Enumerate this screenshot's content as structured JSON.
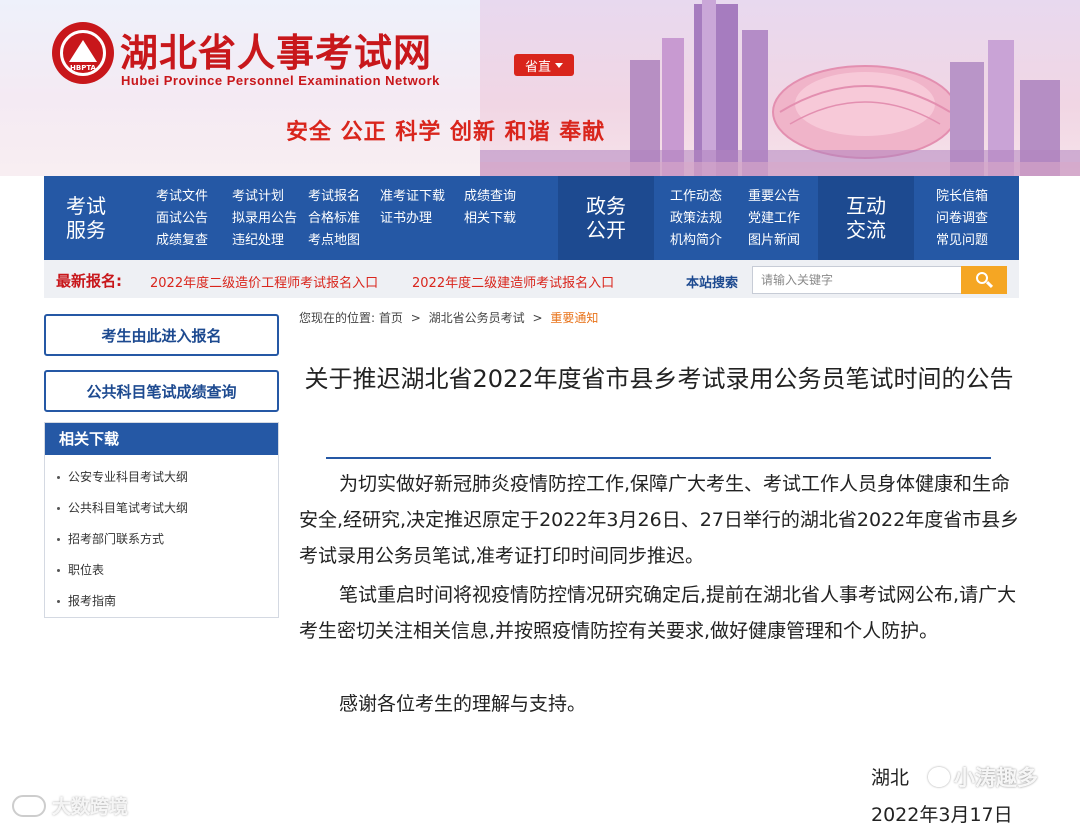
{
  "header": {
    "logo_abbr": "HBPTA",
    "site_title": "湖北省人事考试网",
    "site_subtitle": "Hubei Province Personnel Examination Network",
    "region_button": "省直",
    "slogan": "安全 公正 科学 创新 和谐 奉献",
    "brand_red": "#c8171b"
  },
  "nav": {
    "bar_color": "#2558a5",
    "exam_service": {
      "title_line1": "考试",
      "title_line2": "服务",
      "links": [
        "考试文件",
        "考试计划",
        "考试报名",
        "准考证下载",
        "成绩查询",
        "面试公告",
        "拟录用公告",
        "合格标准",
        "证书办理",
        "相关下载",
        "成绩复查",
        "违纪处理",
        "考点地图"
      ]
    },
    "gov_affairs": {
      "title_line1": "政务",
      "title_line2": "公开",
      "links": [
        "工作动态",
        "重要公告",
        "政策法规",
        "党建工作",
        "机构简介",
        "图片新闻"
      ]
    },
    "interaction": {
      "title_line1": "互动",
      "title_line2": "交流",
      "links": [
        "院长信箱",
        "问卷调查",
        "常见问题"
      ]
    }
  },
  "latest": {
    "label": "最新报名:",
    "links": [
      "2022年度二级造价工程师考试报名入口",
      "2022年度二级建造师考试报名入口"
    ],
    "search_label": "本站搜索",
    "search_placeholder": "请输入关键字"
  },
  "sidebar": {
    "register_button": "考生由此进入报名",
    "score_button": "公共科目笔试成绩查询",
    "downloads_title": "相关下载",
    "downloads": [
      "公安专业科目考试大纲",
      "公共科目笔试考试大纲",
      "招考部门联系方式",
      "职位表",
      "报考指南"
    ]
  },
  "breadcrumb": {
    "prefix": "您现在的位置:",
    "items": [
      "首页",
      "湖北省公务员考试"
    ],
    "current": "重要通知",
    "separator": ">"
  },
  "article": {
    "title": "关于推迟湖北省2022年度省市县乡考试录用公务员笔试时间的公告",
    "paragraphs": [
      "为切实做好新冠肺炎疫情防控工作,保障广大考生、考试工作人员身体健康和生命安全,经研究,决定推迟原定于2022年3月26日、27日举行的湖北省2022年度省市县乡考试录用公务员笔试,准考证打印时间同步推迟。",
      "笔试重启时间将视疫情防控情况研究确定后,提前在湖北省人事考试网公布,请广大考生密切关注相关信息,并按照疫情防控有关要求,做好健康管理和个人防护。",
      "感谢各位考生的理解与支持。"
    ],
    "sign_org": "湖北",
    "sign_date": "2022年3月17日"
  },
  "watermarks": {
    "left": "大数跨境",
    "right": "小涛趣多"
  }
}
